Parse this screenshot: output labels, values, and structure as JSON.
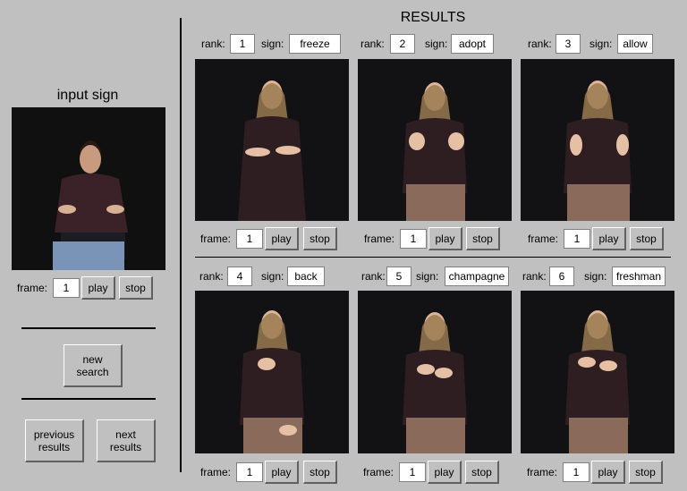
{
  "input": {
    "heading": "input sign",
    "frame_label": "frame:",
    "frame_value": "1",
    "play_label": "play",
    "stop_label": "stop"
  },
  "controls": {
    "new_search_line1": "new",
    "new_search_line2": "search",
    "previous_line1": "previous",
    "previous_line2": "results",
    "next_line1": "next",
    "next_line2": "results"
  },
  "results": {
    "heading": "RESULTS",
    "rank_label": "rank:",
    "sign_label": "sign:",
    "frame_label": "frame:",
    "play_label": "play",
    "stop_label": "stop",
    "items": [
      {
        "rank": "1",
        "sign": "freeze",
        "frame": "1"
      },
      {
        "rank": "2",
        "sign": "adopt",
        "frame": "1"
      },
      {
        "rank": "3",
        "sign": "allow",
        "frame": "1"
      },
      {
        "rank": "4",
        "sign": "back",
        "frame": "1"
      },
      {
        "rank": "5",
        "sign": "champagne",
        "frame": "1"
      },
      {
        "rank": "6",
        "sign": "freshman",
        "frame": "1"
      }
    ]
  }
}
